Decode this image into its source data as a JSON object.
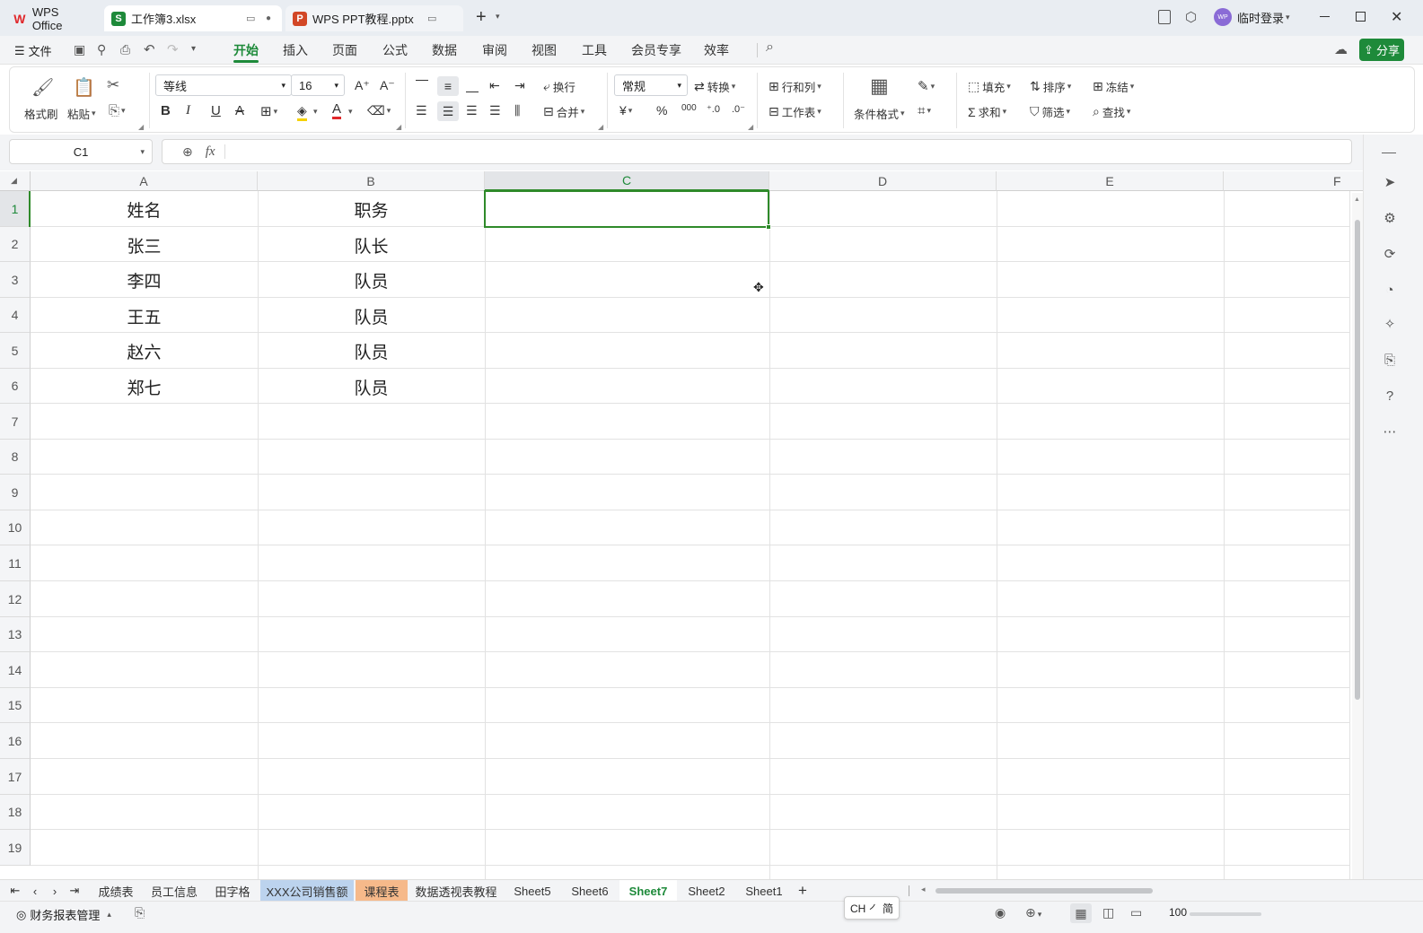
{
  "titlebar": {
    "tabs": [
      {
        "label": "WPS Office",
        "icon": "wps-logo-icon"
      },
      {
        "label": "工作簿3.xlsx",
        "icon": "spreadsheet-s-icon"
      },
      {
        "label": "WPS PPT教程.pptx",
        "icon": "presentation-p-icon"
      }
    ],
    "user_label": "临时登录",
    "avatar_text": "WP"
  },
  "menubar": {
    "file_label": "文件",
    "tabs": [
      "开始",
      "插入",
      "页面",
      "公式",
      "数据",
      "审阅",
      "视图",
      "工具",
      "会员专享",
      "效率"
    ],
    "active_tab": "开始",
    "share_label": "分享"
  },
  "ribbon": {
    "format_painter": "格式刷",
    "paste": "粘贴",
    "font_name": "等线",
    "font_size": "16",
    "bold": "B",
    "italic": "I",
    "underline": "U",
    "wrap": "换行",
    "merge": "合并",
    "number_format": "常规",
    "convert": "转换",
    "currency": "¥",
    "percent": "%",
    "thousands": "000",
    "rows_cols": "行和列",
    "worksheet": "工作表",
    "conditional_format": "条件格式",
    "fill": "填充",
    "sort": "排序",
    "freeze": "冻结",
    "sum": "求和",
    "filter": "筛选",
    "find": "查找"
  },
  "formulabar": {
    "name_box": "C1",
    "fx_label": "fx",
    "formula_value": ""
  },
  "sheet": {
    "columns": [
      "A",
      "B",
      "C",
      "D",
      "E",
      "F"
    ],
    "rows": [
      "1",
      "2",
      "3",
      "4",
      "5",
      "6",
      "7",
      "8",
      "9",
      "10",
      "11",
      "12",
      "13",
      "14",
      "15",
      "16",
      "17",
      "18",
      "19"
    ],
    "cells": [
      [
        "姓名",
        "职务"
      ],
      [
        "张三",
        "队长"
      ],
      [
        "李四",
        "队员"
      ],
      [
        "王五",
        "队员"
      ],
      [
        "赵六",
        "队员"
      ],
      [
        "郑七",
        "队员"
      ]
    ],
    "selected_cell": "C1"
  },
  "sheettabs": {
    "tabs": [
      "成绩表",
      "员工信息",
      "田字格",
      "XXX公司销售额",
      "课程表",
      "数据透视表教程",
      "Sheet5",
      "Sheet6",
      "Sheet7",
      "Sheet2",
      "Sheet1"
    ],
    "active": "Sheet7",
    "add_label": "+"
  },
  "statusbar": {
    "left_label": "财务报表管理",
    "ime_label": "CH ㇒ 简",
    "zoom": "100"
  },
  "colors": {
    "accent_green": "#1e8a3a",
    "selection_green": "#2f8a2a",
    "sheet_tab_blue": "#bcd3ee",
    "sheet_tab_orange": "#f6b98a"
  }
}
